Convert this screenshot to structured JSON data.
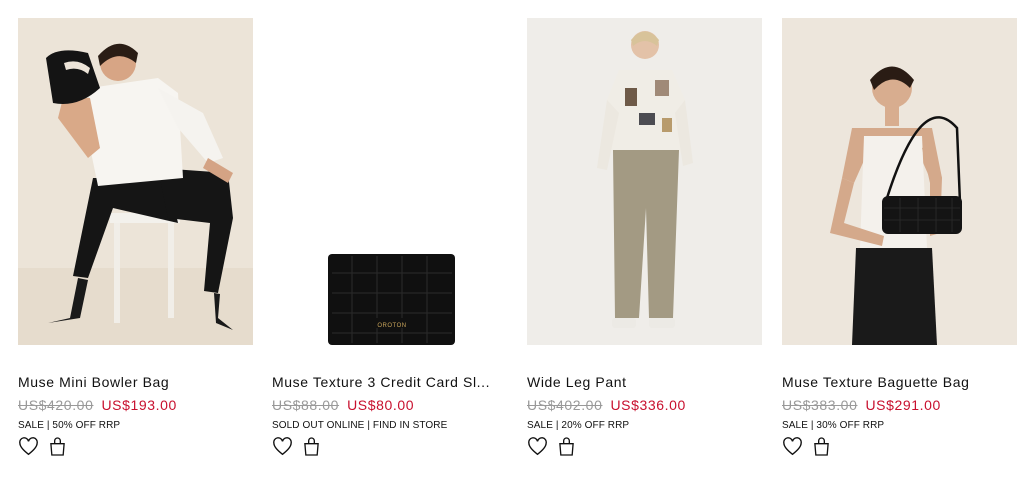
{
  "products": [
    {
      "name": "Muse Mini Bowler Bag",
      "was_price": "US$420.00",
      "sale_price": "US$193.00",
      "badge": "SALE | 50% OFF RRP"
    },
    {
      "name": "Muse Texture 3 Credit Card Sl...",
      "was_price": "US$88.00",
      "sale_price": "US$80.00",
      "badge": "SOLD OUT ONLINE | FIND IN STORE",
      "brand_stamp": "OROTON"
    },
    {
      "name": "Wide Leg Pant",
      "was_price": "US$402.00",
      "sale_price": "US$336.00",
      "badge": "SALE | 20% OFF RRP"
    },
    {
      "name": "Muse Texture Baguette Bag",
      "was_price": "US$383.00",
      "sale_price": "US$291.00",
      "badge": "SALE | 30% OFF RRP"
    }
  ],
  "icons": {
    "wishlist": "heart-icon",
    "cart": "shopping-bag-icon"
  },
  "colors": {
    "sale_price": "#c8102e",
    "was_price": "#999999"
  }
}
